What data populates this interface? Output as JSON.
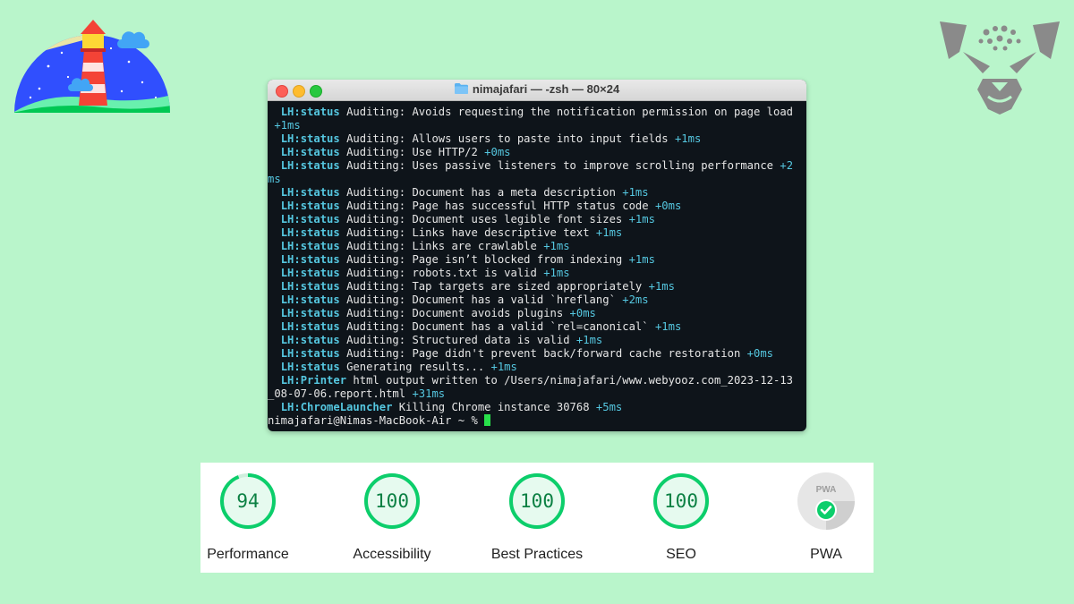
{
  "window": {
    "title": "nimajafari — -zsh — 80×24"
  },
  "terminal": {
    "lines": [
      [
        {
          "t": "  "
        },
        {
          "t": "LH:status",
          "c": "tag"
        },
        {
          "t": " Auditing: Avoids requesting the notification permission on page load"
        }
      ],
      [
        {
          "t": " "
        },
        {
          "t": "+1ms",
          "c": "dur"
        }
      ],
      [
        {
          "t": "  "
        },
        {
          "t": "LH:status",
          "c": "tag"
        },
        {
          "t": " Auditing: Allows users to paste into input fields "
        },
        {
          "t": "+1ms",
          "c": "dur"
        }
      ],
      [
        {
          "t": "  "
        },
        {
          "t": "LH:status",
          "c": "tag"
        },
        {
          "t": " Auditing: Use HTTP/2 "
        },
        {
          "t": "+0ms",
          "c": "dur"
        }
      ],
      [
        {
          "t": "  "
        },
        {
          "t": "LH:status",
          "c": "tag"
        },
        {
          "t": " Auditing: Uses passive listeners to improve scrolling performance "
        },
        {
          "t": "+2",
          "c": "dur"
        }
      ],
      [
        {
          "t": "ms",
          "c": "dur"
        }
      ],
      [
        {
          "t": "  "
        },
        {
          "t": "LH:status",
          "c": "tag"
        },
        {
          "t": " Auditing: Document has a meta description "
        },
        {
          "t": "+1ms",
          "c": "dur"
        }
      ],
      [
        {
          "t": "  "
        },
        {
          "t": "LH:status",
          "c": "tag"
        },
        {
          "t": " Auditing: Page has successful HTTP status code "
        },
        {
          "t": "+0ms",
          "c": "dur"
        }
      ],
      [
        {
          "t": "  "
        },
        {
          "t": "LH:status",
          "c": "tag"
        },
        {
          "t": " Auditing: Document uses legible font sizes "
        },
        {
          "t": "+1ms",
          "c": "dur"
        }
      ],
      [
        {
          "t": "  "
        },
        {
          "t": "LH:status",
          "c": "tag"
        },
        {
          "t": " Auditing: Links have descriptive text "
        },
        {
          "t": "+1ms",
          "c": "dur"
        }
      ],
      [
        {
          "t": "  "
        },
        {
          "t": "LH:status",
          "c": "tag"
        },
        {
          "t": " Auditing: Links are crawlable "
        },
        {
          "t": "+1ms",
          "c": "dur"
        }
      ],
      [
        {
          "t": "  "
        },
        {
          "t": "LH:status",
          "c": "tag"
        },
        {
          "t": " Auditing: Page isn’t blocked from indexing "
        },
        {
          "t": "+1ms",
          "c": "dur"
        }
      ],
      [
        {
          "t": "  "
        },
        {
          "t": "LH:status",
          "c": "tag"
        },
        {
          "t": " Auditing: robots.txt is valid "
        },
        {
          "t": "+1ms",
          "c": "dur"
        }
      ],
      [
        {
          "t": "  "
        },
        {
          "t": "LH:status",
          "c": "tag"
        },
        {
          "t": " Auditing: Tap targets are sized appropriately "
        },
        {
          "t": "+1ms",
          "c": "dur"
        }
      ],
      [
        {
          "t": "  "
        },
        {
          "t": "LH:status",
          "c": "tag"
        },
        {
          "t": " Auditing: Document has a valid `hreflang` "
        },
        {
          "t": "+2ms",
          "c": "dur"
        }
      ],
      [
        {
          "t": "  "
        },
        {
          "t": "LH:status",
          "c": "tag"
        },
        {
          "t": " Auditing: Document avoids plugins "
        },
        {
          "t": "+0ms",
          "c": "dur"
        }
      ],
      [
        {
          "t": "  "
        },
        {
          "t": "LH:status",
          "c": "tag"
        },
        {
          "t": " Auditing: Document has a valid `rel=canonical` "
        },
        {
          "t": "+1ms",
          "c": "dur"
        }
      ],
      [
        {
          "t": "  "
        },
        {
          "t": "LH:status",
          "c": "tag"
        },
        {
          "t": " Auditing: Structured data is valid "
        },
        {
          "t": "+1ms",
          "c": "dur"
        }
      ],
      [
        {
          "t": "  "
        },
        {
          "t": "LH:status",
          "c": "tag"
        },
        {
          "t": " Auditing: Page didn't prevent back/forward cache restoration "
        },
        {
          "t": "+0ms",
          "c": "dur"
        }
      ],
      [
        {
          "t": "  "
        },
        {
          "t": "LH:status",
          "c": "tag"
        },
        {
          "t": " Generating results... "
        },
        {
          "t": "+1ms",
          "c": "dur"
        }
      ],
      [
        {
          "t": "  "
        },
        {
          "t": "LH:Printer",
          "c": "tag"
        },
        {
          "t": " html output written to /Users/nimajafari/www.webyooz.com_2023-12-13"
        }
      ],
      [
        {
          "t": "_08-07-06.report.html "
        },
        {
          "t": "+31ms",
          "c": "dur"
        }
      ],
      [
        {
          "t": "  "
        },
        {
          "t": "LH:ChromeLauncher",
          "c": "tag"
        },
        {
          "t": " Killing Chrome instance 30768 "
        },
        {
          "t": "+5ms",
          "c": "dur"
        }
      ],
      [
        {
          "t": "nimajafari@Nimas-MacBook-Air ~ % "
        },
        {
          "t": "",
          "c": "cursor"
        }
      ]
    ]
  },
  "scores": [
    {
      "label": "Performance",
      "value": "94",
      "fraction": 0.94,
      "color": "#0cce6b"
    },
    {
      "label": "Accessibility",
      "value": "100",
      "fraction": 1.0,
      "color": "#0cce6b"
    },
    {
      "label": "Best Practices",
      "value": "100",
      "fraction": 1.0,
      "color": "#0cce6b"
    },
    {
      "label": "SEO",
      "value": "100",
      "fraction": 1.0,
      "color": "#0cce6b"
    }
  ],
  "pwa": {
    "badge_text": "PWA",
    "label": "PWA"
  },
  "colors": {
    "background": "#b9f5cb",
    "terminal_bg": "#0e141a",
    "tag": "#55c7e0",
    "cursor": "#28e04a",
    "score_pass": "#0cce6b",
    "score_text": "#0b8043"
  },
  "icons": {
    "left_logo": "lighthouse-logo",
    "right_logo": "cheetah-logo",
    "folder": "folder-icon",
    "pwa_check": "check-circle-icon"
  }
}
